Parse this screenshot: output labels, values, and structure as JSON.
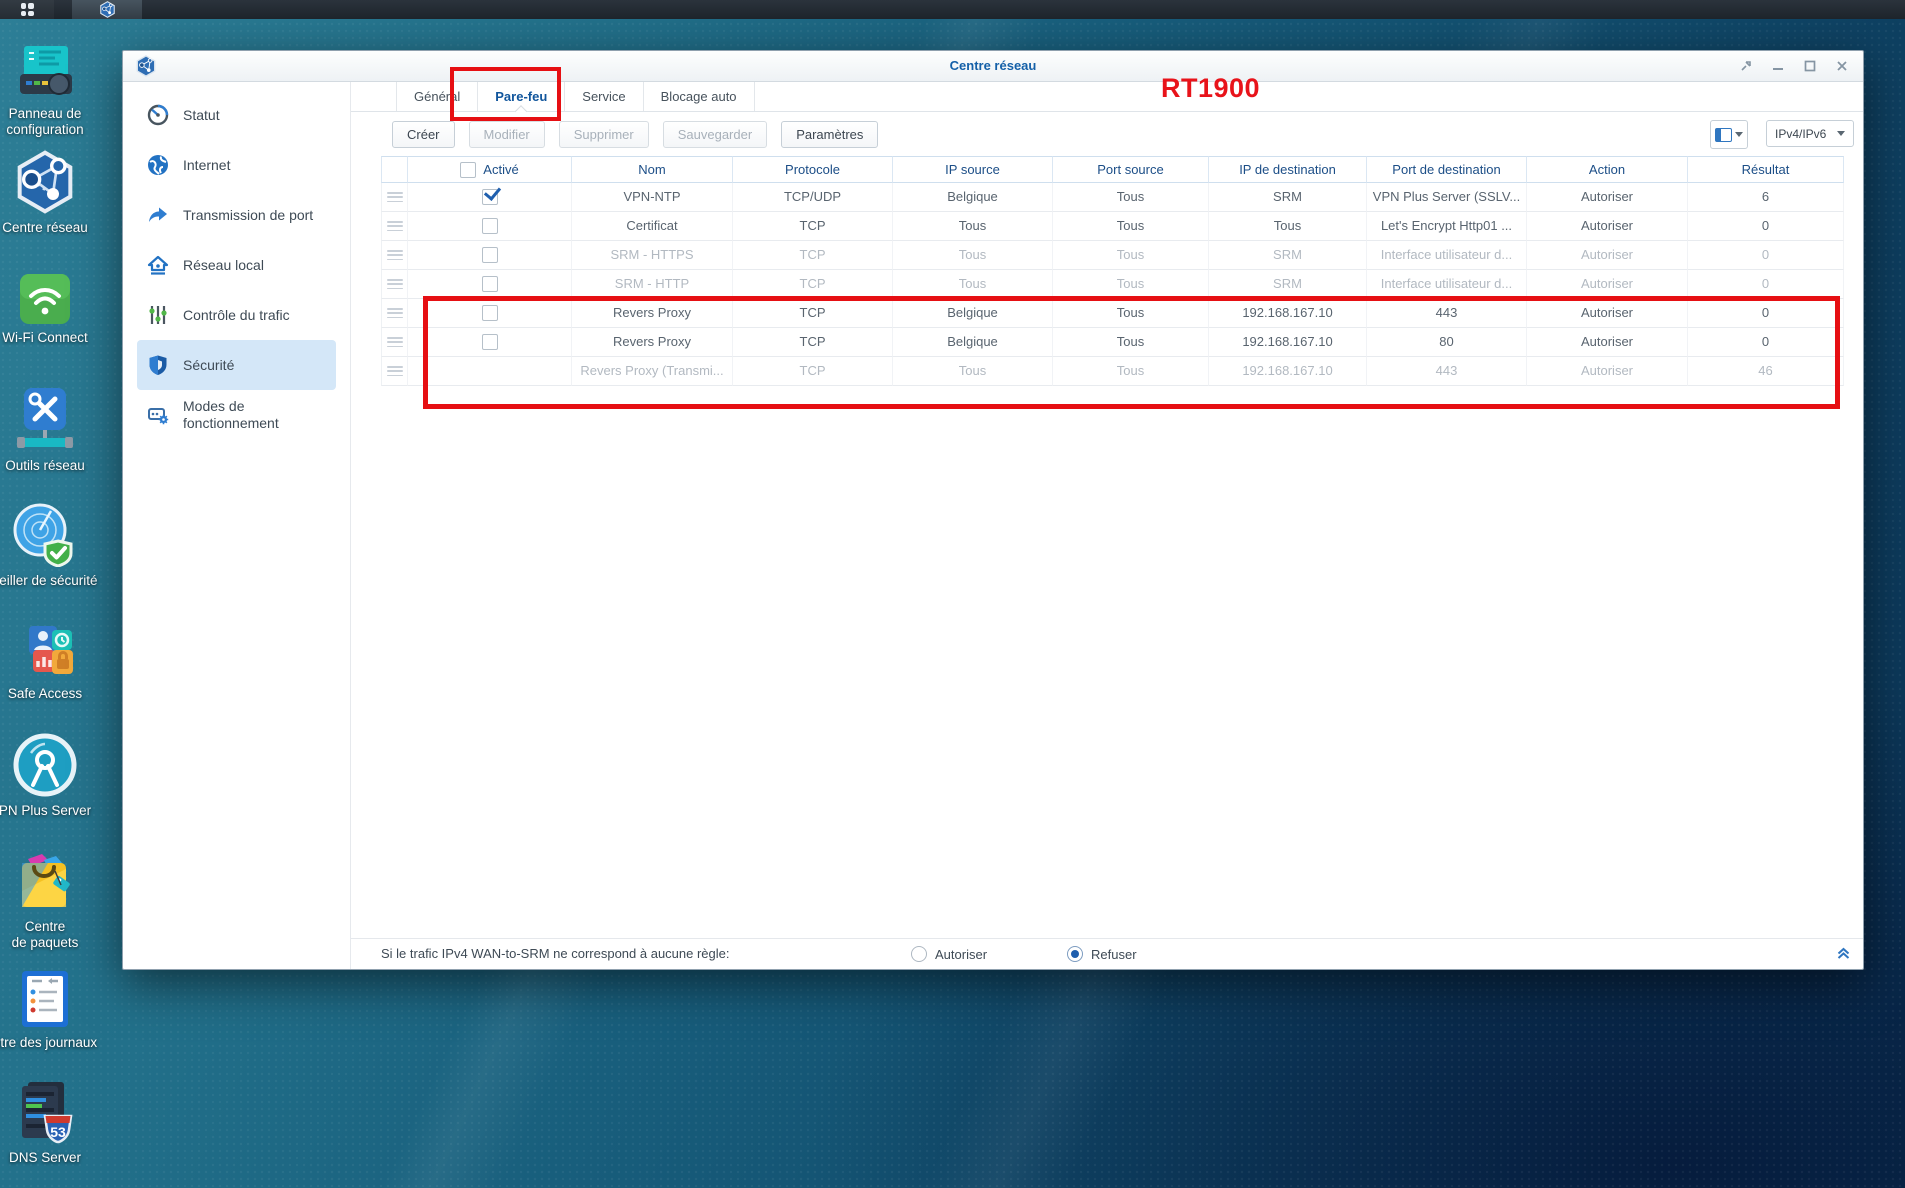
{
  "annotation_color": "#e60f13",
  "taskbar": {
    "active_app": "Centre réseau"
  },
  "desktop": {
    "icons": [
      {
        "id": "panneau-de-configuration",
        "label": "Panneau de",
        "label2": "configuration"
      },
      {
        "id": "centre-reseau",
        "label": "Centre réseau",
        "label2": ""
      },
      {
        "id": "wifi-connect",
        "label": "Wi-Fi Connect",
        "label2": ""
      },
      {
        "id": "outils-reseau",
        "label": "Outils réseau",
        "label2": ""
      },
      {
        "id": "conseiller-de-securite",
        "label": "seiller de sécurité",
        "label2": ""
      },
      {
        "id": "safe-access",
        "label": "Safe Access",
        "label2": ""
      },
      {
        "id": "vpn-plus-server",
        "label": "PN Plus Server",
        "label2": ""
      },
      {
        "id": "centre-de-paquets",
        "label": "Centre",
        "label2": "de paquets"
      },
      {
        "id": "centre-des-journaux",
        "label": "ntre des journaux",
        "label2": ""
      },
      {
        "id": "dns-server",
        "label": "DNS Server",
        "label2": ""
      }
    ]
  },
  "window": {
    "title": "Centre réseau",
    "annotation_model": "RT1900",
    "sidebar": {
      "items": [
        {
          "label": "Statut",
          "label2": ""
        },
        {
          "label": "Internet",
          "label2": ""
        },
        {
          "label": "Transmission de port",
          "label2": ""
        },
        {
          "label": "Réseau local",
          "label2": ""
        },
        {
          "label": "Contrôle du trafic",
          "label2": ""
        },
        {
          "label": "Sécurité",
          "label2": "",
          "selected": true
        },
        {
          "label": "Modes de",
          "label2": "fonctionnement"
        }
      ]
    },
    "tabs": [
      {
        "label": "Général"
      },
      {
        "label": "Pare-feu",
        "active": true,
        "red_boxed": true
      },
      {
        "label": "Service"
      },
      {
        "label": "Blocage auto"
      }
    ],
    "toolbar": {
      "buttons": [
        {
          "label": "Créer",
          "enabled": true
        },
        {
          "label": "Modifier",
          "enabled": false
        },
        {
          "label": "Supprimer",
          "enabled": false
        },
        {
          "label": "Sauvegarder",
          "enabled": false
        },
        {
          "label": "Paramètres",
          "enabled": true
        }
      ],
      "ip_filter_value": "IPv4/IPv6"
    },
    "table": {
      "columns": [
        "",
        "Activé",
        "Nom",
        "Protocole",
        "IP source",
        "Port source",
        "IP de destination",
        "Port de destination",
        "Action",
        "Résultat"
      ],
      "rows": [
        {
          "enabled": "checked",
          "name": "VPN-NTP",
          "protocol": "TCP/UDP",
          "ip_src": "Belgique",
          "port_src": "Tous",
          "ip_dst": "SRM",
          "port_dst": "VPN Plus Server (SSLV...",
          "action": "Autoriser",
          "result": "6",
          "muted": false
        },
        {
          "enabled": "unchecked",
          "name": "Certificat",
          "protocol": "TCP",
          "ip_src": "Tous",
          "port_src": "Tous",
          "ip_dst": "Tous",
          "port_dst": "Let's Encrypt Http01 ...",
          "action": "Autoriser",
          "result": "0",
          "muted": false
        },
        {
          "enabled": "unchecked",
          "name": "SRM - HTTPS",
          "protocol": "TCP",
          "ip_src": "Tous",
          "port_src": "Tous",
          "ip_dst": "SRM",
          "port_dst": "Interface utilisateur d...",
          "action": "Autoriser",
          "result": "0",
          "muted": true
        },
        {
          "enabled": "unchecked",
          "name": "SRM - HTTP",
          "protocol": "TCP",
          "ip_src": "Tous",
          "port_src": "Tous",
          "ip_dst": "SRM",
          "port_dst": "Interface utilisateur d...",
          "action": "Autoriser",
          "result": "0",
          "muted": true
        },
        {
          "enabled": "unchecked",
          "name": "Revers Proxy",
          "protocol": "TCP",
          "ip_src": "Belgique",
          "port_src": "Tous",
          "ip_dst": "192.168.167.10",
          "port_dst": "443",
          "action": "Autoriser",
          "result": "0",
          "muted": false
        },
        {
          "enabled": "unchecked",
          "name": "Revers Proxy",
          "protocol": "TCP",
          "ip_src": "Belgique",
          "port_src": "Tous",
          "ip_dst": "192.168.167.10",
          "port_dst": "80",
          "action": "Autoriser",
          "result": "0",
          "muted": false
        },
        {
          "enabled": "none",
          "name": "Revers Proxy (Transmi...",
          "protocol": "TCP",
          "ip_src": "Tous",
          "port_src": "Tous",
          "ip_dst": "192.168.167.10",
          "port_dst": "443",
          "action": "Autoriser",
          "result": "46",
          "muted": true
        }
      ]
    },
    "footer": {
      "label": "Si le trafic IPv4 WAN-to-SRM ne correspond à aucune règle:",
      "options": [
        {
          "label": "Autoriser",
          "selected": false
        },
        {
          "label": "Refuser",
          "selected": true
        }
      ]
    }
  }
}
